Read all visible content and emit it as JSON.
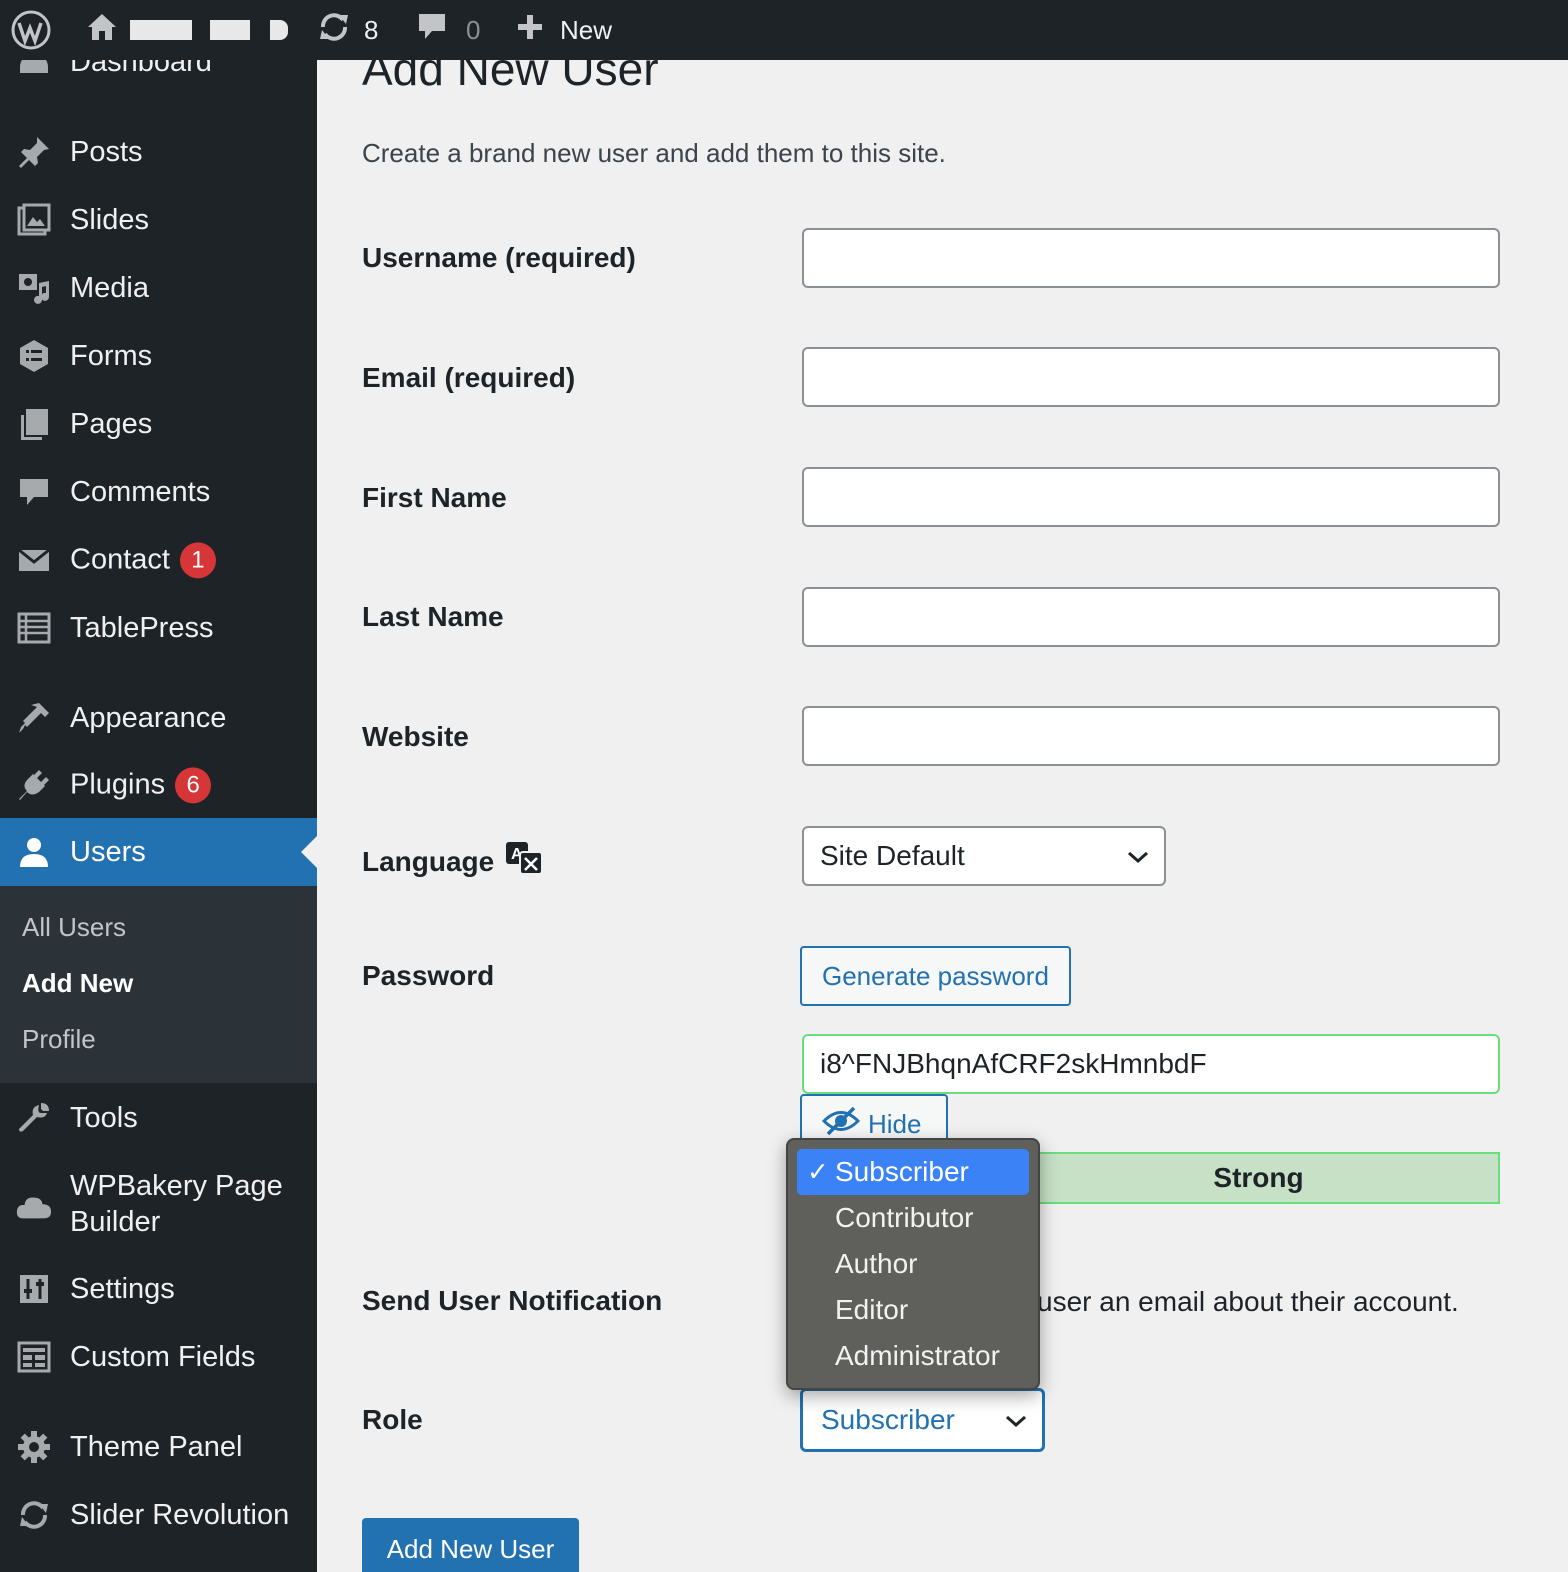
{
  "admin_bar": {
    "updates_count": "8",
    "comments_count": "0",
    "new_label": "New"
  },
  "sidebar": {
    "items": [
      {
        "label": "Dashboard",
        "icon": "dashboard-icon"
      },
      {
        "label": "Posts",
        "icon": "pin-icon"
      },
      {
        "label": "Slides",
        "icon": "slides-icon"
      },
      {
        "label": "Media",
        "icon": "media-icon"
      },
      {
        "label": "Forms",
        "icon": "forms-icon"
      },
      {
        "label": "Pages",
        "icon": "pages-icon"
      },
      {
        "label": "Comments",
        "icon": "comment-icon"
      },
      {
        "label": "Contact",
        "icon": "envelope-icon",
        "badge": "1"
      },
      {
        "label": "TablePress",
        "icon": "table-icon"
      },
      {
        "label": "Appearance",
        "icon": "brush-icon"
      },
      {
        "label": "Plugins",
        "icon": "plugin-icon",
        "badge": "6"
      },
      {
        "label": "Users",
        "icon": "user-icon",
        "current": true
      },
      {
        "label": "Tools",
        "icon": "wrench-icon"
      },
      {
        "label": "WPBakery Page Builder",
        "icon": "cloud-icon"
      },
      {
        "label": "Settings",
        "icon": "settings-icon"
      },
      {
        "label": "Custom Fields",
        "icon": "fields-icon"
      },
      {
        "label": "Theme Panel",
        "icon": "gear-icon"
      },
      {
        "label": "Slider Revolution",
        "icon": "refresh-icon"
      }
    ],
    "users_submenu": [
      "All Users",
      "Add New",
      "Profile"
    ]
  },
  "main": {
    "title": "Add New User",
    "description": "Create a brand new user and add them to this site.",
    "fields": {
      "username_label": "Username (required)",
      "email_label": "Email (required)",
      "first_name_label": "First Name",
      "last_name_label": "Last Name",
      "website_label": "Website",
      "language_label": "Language",
      "language_value": "Site Default",
      "password_label": "Password",
      "generate_password_label": "Generate password",
      "password_value": "i8^FNJBhqnAfCRF2skHmnbdF",
      "hide_label": "Hide",
      "strength_label": "Strong",
      "notification_label": "Send User Notification",
      "notification_text_visible": "user an email about their account.",
      "role_label": "Role",
      "role_value": "Subscriber"
    },
    "submit_label": "Add New User"
  },
  "role_dropdown": {
    "check_mark": "✓",
    "options": [
      "Subscriber",
      "Contributor",
      "Author",
      "Editor",
      "Administrator"
    ],
    "selected": "Subscriber"
  },
  "colors": {
    "admin_bar_bg": "#1d2327",
    "accent": "#2271b1",
    "badge": "#d63638",
    "strength_bg": "#c6e1c6",
    "dropdown_bg": "#5f5f5c",
    "dropdown_highlight": "#3b82f6"
  }
}
